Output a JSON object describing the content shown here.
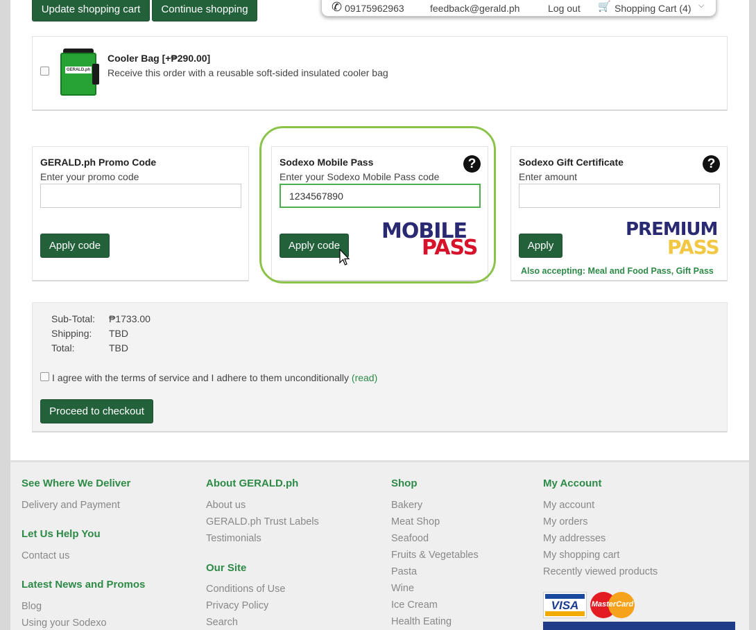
{
  "top_buttons": {
    "update": "Update shopping cart",
    "continue": "Continue shopping"
  },
  "topbar": {
    "phone": "09175962963",
    "email": "feedback@gerald.ph",
    "logout": "Log out",
    "cart": "Shopping Cart (4)"
  },
  "cooler": {
    "title": "Cooler Bag [+₱290.00]",
    "desc": "Receive this order with a reusable soft-sided insulated cooler bag",
    "bag_text": "GERALD.ph"
  },
  "promo": {
    "title": "GERALD.ph Promo Code",
    "label": "Enter your promo code",
    "value": "",
    "button": "Apply code"
  },
  "sodexo_mobile": {
    "title": "Sodexo Mobile Pass",
    "label": "Enter your Sodexo Mobile Pass code",
    "value": "1234567890",
    "button": "Apply code",
    "logo_top": "MOBILE",
    "logo_bottom": "PASS"
  },
  "sodexo_gift": {
    "title": "Sodexo Gift Certificate",
    "label": "Enter amount",
    "value": "",
    "button": "Apply",
    "logo_top": "PREMIUM",
    "logo_bottom": "PASS",
    "also": "Also accepting: Meal and Food Pass, Gift Pass"
  },
  "totals": {
    "subtotal_label": "Sub-Total:",
    "subtotal_value": "₱1733.00",
    "shipping_label": "Shipping:",
    "shipping_value": "TBD",
    "total_label": "Total:",
    "total_value": "TBD"
  },
  "terms": {
    "text": "I agree with the terms of service and I adhere to them unconditionally",
    "link": "(read)"
  },
  "checkout": "Proceed to checkout",
  "footer": {
    "col1": {
      "h1": "See Where We Deliver",
      "l1": "Delivery and Payment",
      "h2": "Let Us Help You",
      "l2": "Contact us",
      "h3": "Latest News and Promos",
      "l3": "Blog",
      "l4": "Using your Sodexo"
    },
    "col2": {
      "h1": "About GERALD.ph",
      "links": [
        "About us",
        "GERALD.ph Trust Labels",
        "Testimonials"
      ],
      "h2": "Our Site",
      "links2": [
        "Conditions of Use",
        "Privacy Policy",
        "Search"
      ]
    },
    "col3": {
      "h1": "Shop",
      "links": [
        "Bakery",
        "Meat Shop",
        "Seafood",
        "Fruits & Vegetables",
        "Pasta",
        "Wine",
        "Ice Cream",
        "Health Eating"
      ]
    },
    "col4": {
      "h1": "My Account",
      "links": [
        "My account",
        "My orders",
        "My addresses",
        "My shopping cart",
        "Recently viewed products"
      ],
      "visa": "VISA",
      "mastercard": "MasterCard"
    }
  }
}
